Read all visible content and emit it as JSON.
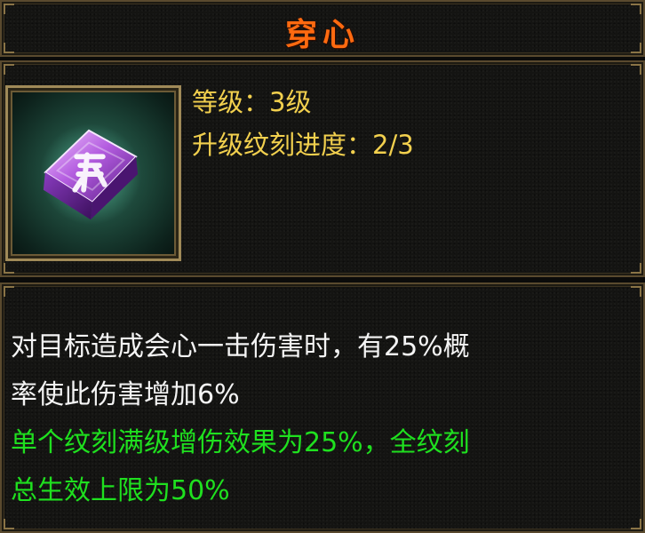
{
  "colors": {
    "title": "#ff6a10",
    "stat": "#f2d04e",
    "description_white": "#f4f4f4",
    "description_green": "#1fe01f"
  },
  "title": "穿心",
  "info": {
    "icon": "purple-rune-gem-icon",
    "level_line": "等级：3级",
    "progress_line": "升级纹刻进度：2/3"
  },
  "description": {
    "effect_line_1": "对目标造成会心一击伤害时，有25%概",
    "effect_line_2": "率使此伤害增加6%",
    "cap_line_1": "单个纹刻满级增伤效果为25%，全纹刻",
    "cap_line_2": "总生效上限为50%"
  }
}
